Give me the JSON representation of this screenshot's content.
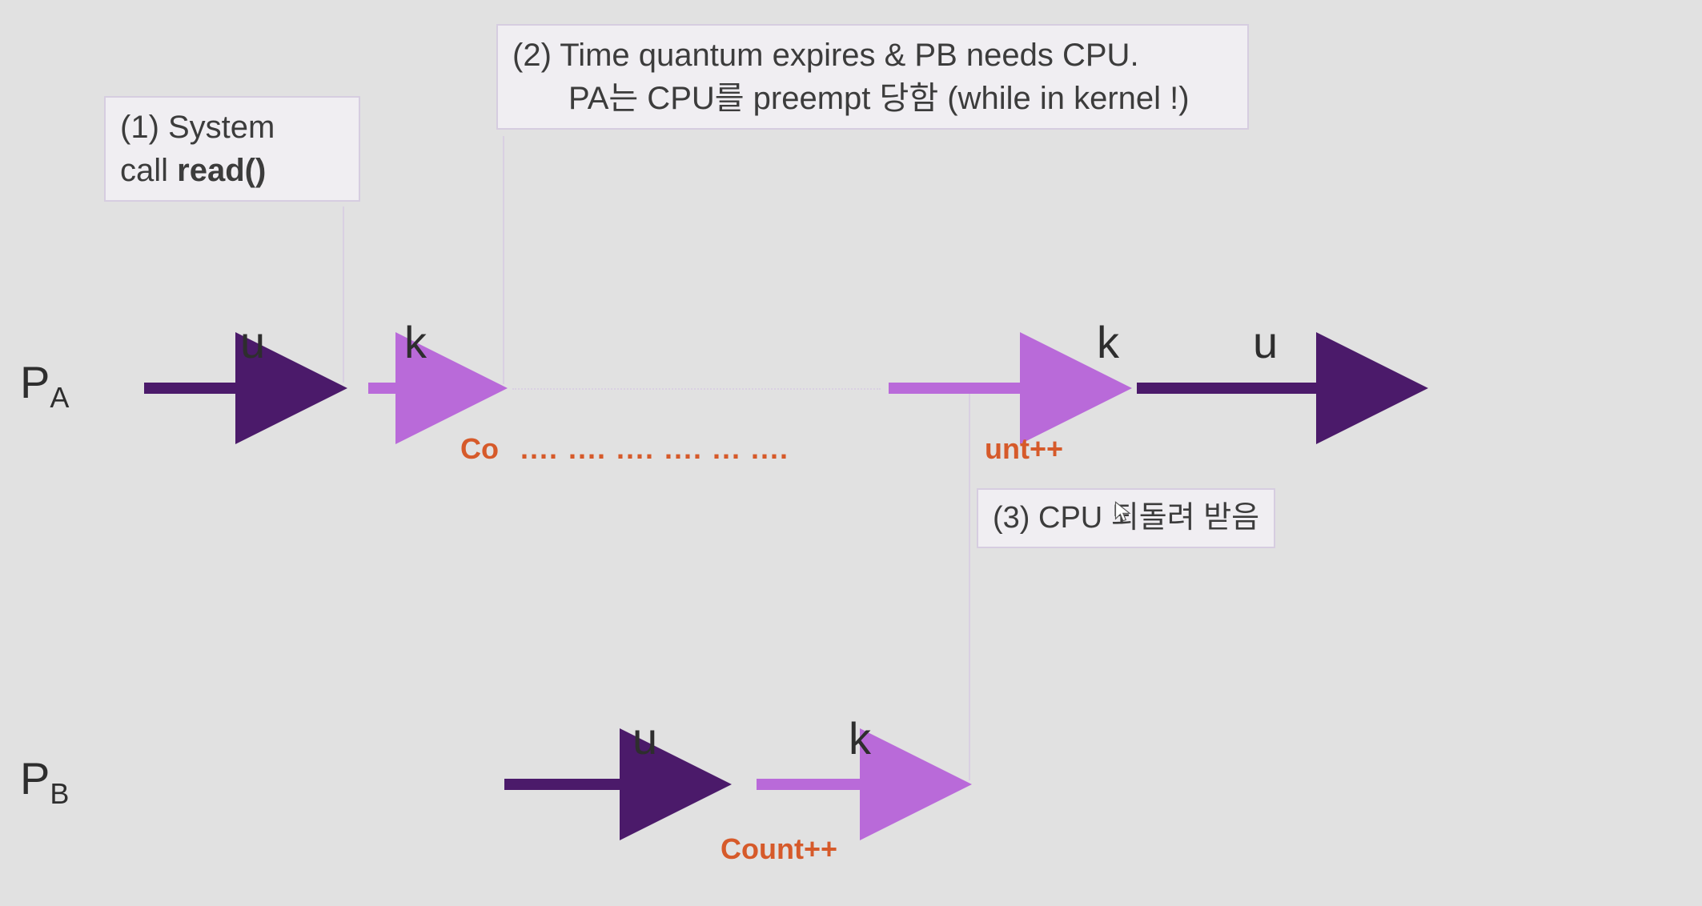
{
  "processA": {
    "name": "P",
    "sub": "A"
  },
  "processB": {
    "name": "P",
    "sub": "B"
  },
  "box1": {
    "line1": "(1) System",
    "line2_a": "call  ",
    "line2_b": "read()"
  },
  "box2": {
    "line1": "(2) Time quantum expires & PB needs CPU.",
    "line2": "PA는 CPU를 preempt 당함 (while in kernel !)"
  },
  "box3": {
    "text": "(3) CPU 되돌려 받음"
  },
  "modes": {
    "u": "u",
    "k": "k"
  },
  "count": {
    "left": "Co",
    "dots": "....  ....  ....   ....    ...   ....",
    "right": "unt++",
    "full": "Count++"
  },
  "colors": {
    "darkPurple": "#4b1a6a",
    "lightPurple": "#b96ad9",
    "orange": "#d65a2a",
    "boxBorder": "#d6cde0",
    "boxFill": "#f0eef2",
    "guide": "#d9d0e2"
  }
}
